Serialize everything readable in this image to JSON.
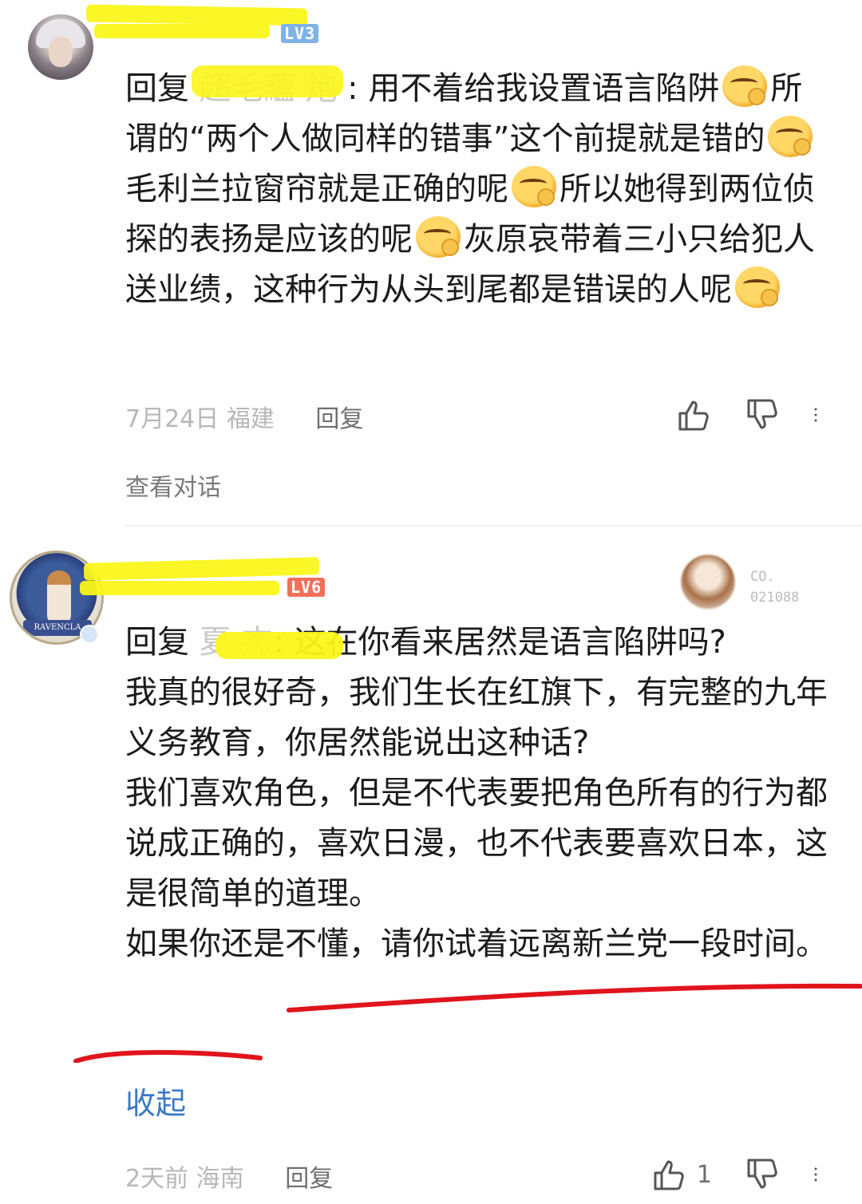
{
  "comments": [
    {
      "username_hidden": true,
      "level_badge": "LV3",
      "reply_prefix": "回复",
      "reply_to_hidden": "超毛蘊 炮",
      "body_parts": [
        {
          "type": "text",
          "value": ": 用不着给我设置语言陷阱"
        },
        {
          "type": "emoji",
          "name": "smug-face-ok-emoji"
        },
        {
          "type": "text",
          "value": "所谓的“两个人做同样的错事”这个前提就是错的"
        },
        {
          "type": "emoji",
          "name": "smug-face-ok-emoji"
        },
        {
          "type": "text",
          "value": "毛利兰拉窗帘就是正确的呢"
        },
        {
          "type": "emoji",
          "name": "smug-face-ok-emoji"
        },
        {
          "type": "text",
          "value": "所以她得到两位侦探的表扬是应该的呢"
        },
        {
          "type": "emoji",
          "name": "smug-face-ok-emoji"
        },
        {
          "type": "text",
          "value": "灰原哀带着三小只给犯人送业绩，这种行为从头到尾都是错误的人呢"
        },
        {
          "type": "emoji",
          "name": "smug-face-ok-emoji"
        }
      ],
      "date": "7月24日",
      "location": "福建",
      "reply_label": "回复",
      "view_thread": "查看对话"
    },
    {
      "level_badge": "LV6",
      "fan_label_line1": "CO.",
      "fan_label_line2": "021088",
      "reply_prefix": "回复",
      "reply_to_hidden": "夏 杰",
      "body_first": ": 这在你看来居然是语言陷阱吗?",
      "body_lines": [
        "我真的很好奇，我们生长在红旗下，有完整的九年义务教育，你居然能说出这种话?",
        "我们喜欢角色，但是不代表要把角色所有的行为都说成正确的，喜欢日漫，也不代表要喜欢日本，这是很简单的道理。",
        "如果你还是不懂，请你试着远离新兰党一段时间。"
      ],
      "collapse_label": "收起",
      "date": "2天前",
      "location": "海南",
      "reply_label": "回复",
      "like_count": "1"
    }
  ],
  "colors": {
    "highlight": "#fbf51a",
    "link_blue": "#3a79c7",
    "red_underline": "#e0141c",
    "meta_gray": "#b7b7b7"
  }
}
